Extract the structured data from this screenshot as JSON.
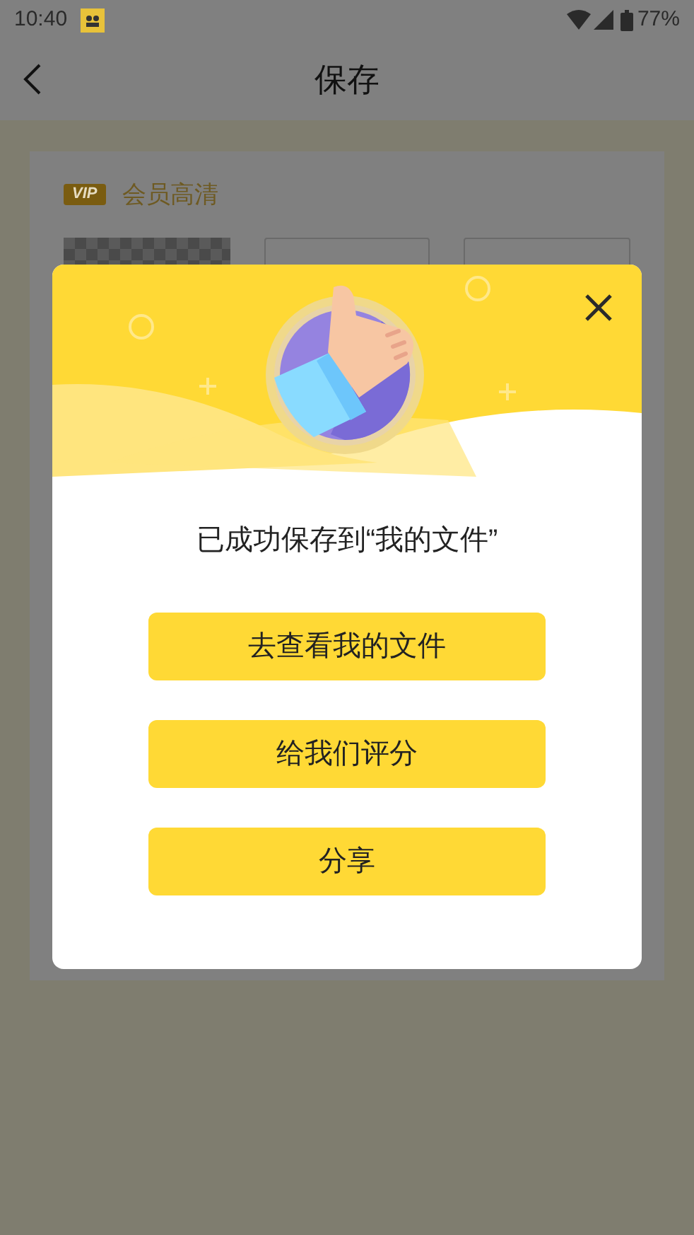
{
  "status_bar": {
    "time": "10:40",
    "battery": "77%"
  },
  "header": {
    "title": "保存"
  },
  "card": {
    "badge": "VIP",
    "title": "会员高清"
  },
  "dialog": {
    "message": "已成功保存到“我的文件”",
    "buttons": [
      "去查看我的文件",
      "给我们评分",
      "分享"
    ]
  }
}
